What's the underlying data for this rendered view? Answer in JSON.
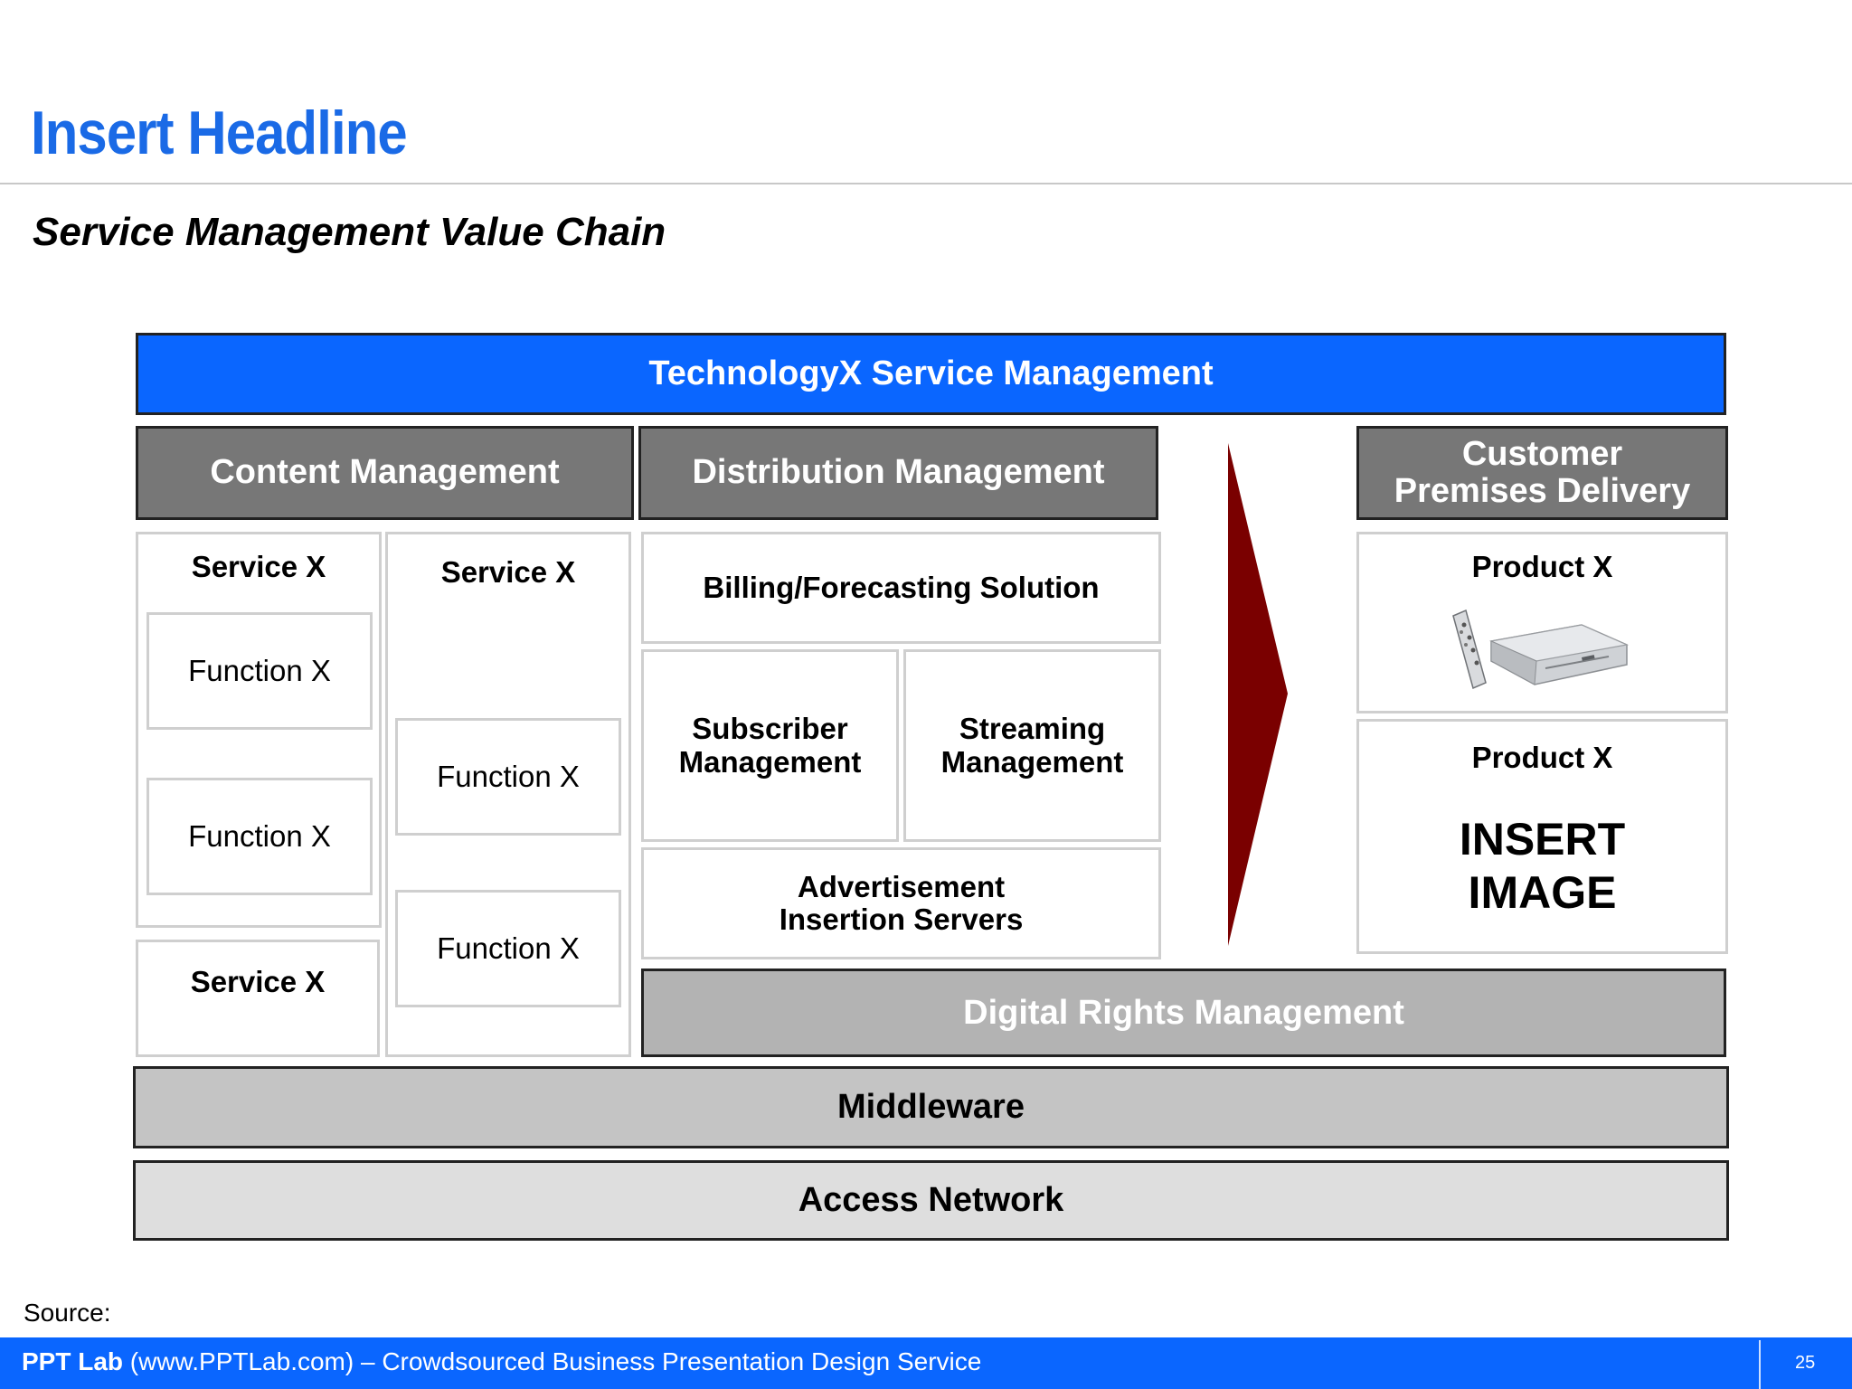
{
  "slide": {
    "headline": "Insert Headline",
    "subtitle": "Service Management Value Chain",
    "source_label": "Source:",
    "footer": {
      "brand": "PPT Lab",
      "text": " (www.PPTLab.com) – Crowdsourced Business Presentation Design Service",
      "page_number": "25"
    },
    "colors": {
      "accent_blue": "#0a66ff",
      "header_gray": "#777777",
      "drm_gray": "#b3b3b3",
      "middleware_gray": "#c4c4c4",
      "access_gray": "#dedede",
      "arrow_red": "#7a0000"
    }
  },
  "diagram": {
    "top_banner": "TechnologyX Service Management",
    "content_management": {
      "header": "Content Management",
      "col1": {
        "service_top": "Service X",
        "function_1": "Function X",
        "function_2": "Function X",
        "service_bottom": "Service X"
      },
      "col2": {
        "service": "Service X",
        "function_1": "Function X",
        "function_2": "Function X"
      }
    },
    "distribution_management": {
      "header": "Distribution Management",
      "billing": "Billing/Forecasting Solution",
      "subscriber": [
        "Subscriber",
        "Management"
      ],
      "streaming": [
        "Streaming",
        "Management"
      ],
      "advertisement": [
        "Advertisement",
        "Insertion Servers"
      ]
    },
    "arrow_icon": "chevron-right-icon",
    "customer_premises": {
      "header": [
        "Customer",
        "Premises Delivery"
      ],
      "product_1": "Product X",
      "product_1_icon": "set-top-box-icon",
      "product_2": "Product X",
      "placeholder": [
        "INSERT",
        "IMAGE"
      ]
    },
    "drm": "Digital Rights Management",
    "middleware": "Middleware",
    "access_network": "Access Network"
  }
}
